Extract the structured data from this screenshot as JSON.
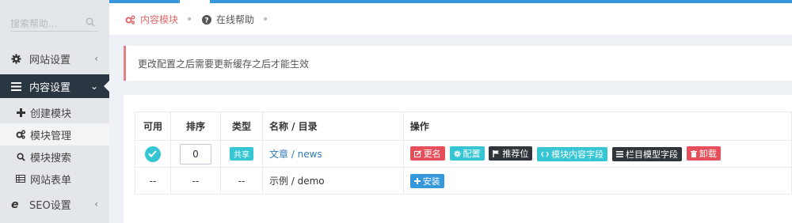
{
  "search": {
    "placeholder": "搜索帮助..."
  },
  "sidebar": {
    "items": [
      {
        "label": "网站设置",
        "icon": "gear-icon"
      },
      {
        "label": "内容设置",
        "icon": "bars-icon"
      },
      {
        "label": "SEO设置",
        "icon": "ie-icon"
      }
    ],
    "subitems": [
      {
        "label": "创建模块",
        "icon": "plus-icon"
      },
      {
        "label": "模块管理",
        "icon": "cogs-icon"
      },
      {
        "label": "模块搜索",
        "icon": "search-icon"
      },
      {
        "label": "网站表单",
        "icon": "table-icon"
      }
    ]
  },
  "breadcrumb": [
    {
      "label": "内容模块",
      "icon": "cogs-icon",
      "color": "#e26a6a"
    },
    {
      "label": "在线帮助",
      "icon": "question-circle-icon"
    }
  ],
  "note": {
    "text": "更改配置之后需要更新缓存之后才能生效"
  },
  "table": {
    "headers": [
      "可用",
      "排序",
      "类型",
      "名称 / 目录",
      "操作"
    ],
    "rows": [
      {
        "order": "0",
        "type": "共享",
        "name": "文章 / news"
      },
      {
        "enabled": "--",
        "order": "--",
        "type": "--",
        "name": "示例 / demo"
      }
    ],
    "actions": [
      {
        "label": "更名",
        "icon": "edit-icon",
        "color": "#e7505a"
      },
      {
        "label": "配置",
        "icon": "gear-icon",
        "color": "#36c6d3"
      },
      {
        "label": "推荐位",
        "icon": "flag-icon",
        "color": "#2f353b"
      },
      {
        "label": "模块内容字段",
        "icon": "code-icon",
        "color": "#36c6d3"
      },
      {
        "label": "栏目模型字段",
        "icon": "list-icon",
        "color": "#2f353b"
      },
      {
        "label": "卸载",
        "icon": "trash-icon",
        "color": "#e7505a"
      }
    ],
    "install": {
      "label": "安装",
      "icon": "plus-icon",
      "color": "#3598dc"
    }
  }
}
